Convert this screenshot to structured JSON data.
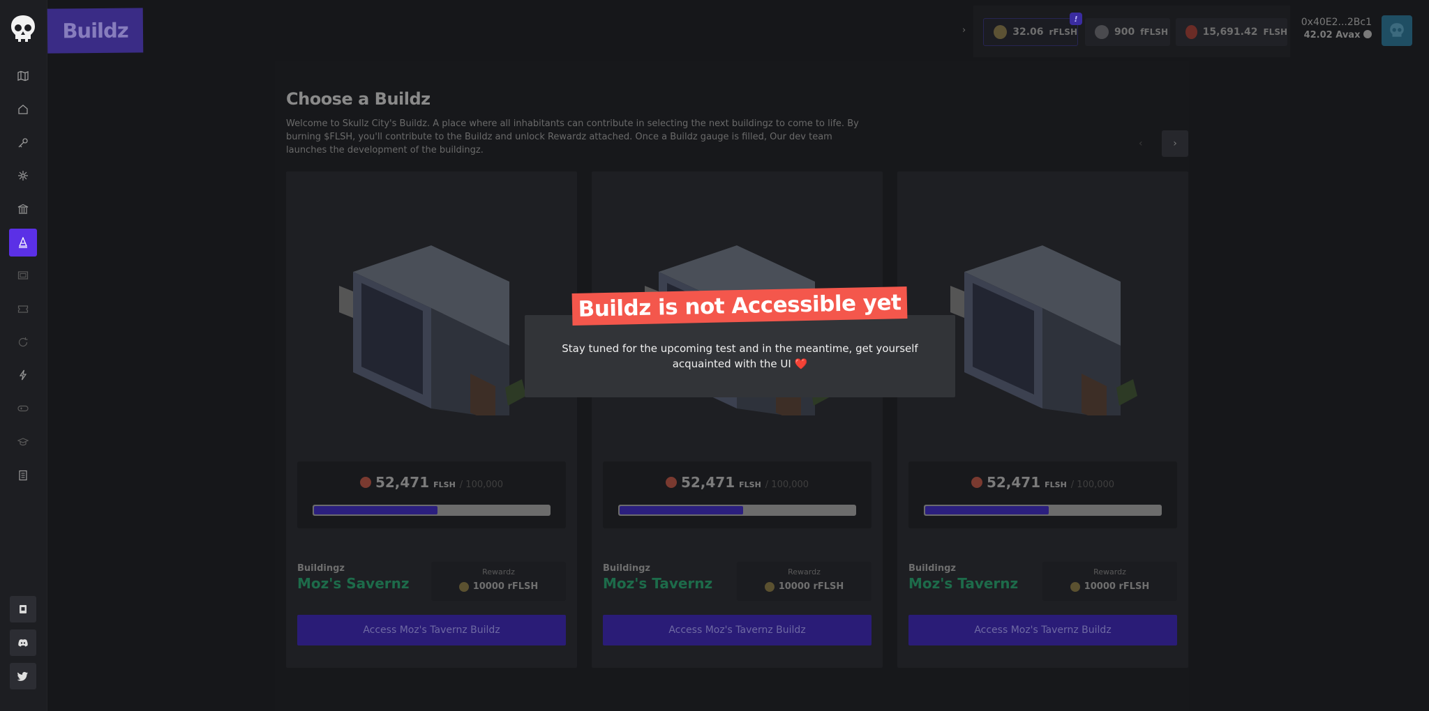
{
  "app": {
    "page_title": "Buildz"
  },
  "sidebar": {
    "items": [
      {
        "name": "map-icon",
        "active": false
      },
      {
        "name": "home-icon",
        "active": false
      },
      {
        "name": "key-icon",
        "active": false
      },
      {
        "name": "sparkle-icon",
        "active": false
      },
      {
        "name": "bank-icon",
        "active": false
      },
      {
        "name": "buildz-icon",
        "active": true
      },
      {
        "name": "frame-icon",
        "active": false
      },
      {
        "name": "ticket-icon",
        "active": false
      },
      {
        "name": "refresh-icon",
        "active": false
      },
      {
        "name": "flash-icon",
        "active": false
      },
      {
        "name": "gamepad-icon",
        "active": false
      },
      {
        "name": "hat-icon",
        "active": false
      },
      {
        "name": "document-icon",
        "active": false
      }
    ],
    "social": [
      "docs-icon",
      "discord-icon",
      "twitter-icon"
    ]
  },
  "topbar": {
    "balances": [
      {
        "value": "32.06",
        "unit": "rFLSH",
        "color": "#5c5234"
      },
      {
        "value": "900",
        "unit": "fFLSH",
        "color": "#4a4a4e"
      },
      {
        "value": "15,691.42",
        "unit": "FLSH",
        "color": "#6b2c26"
      }
    ],
    "notice": "!",
    "address": "0x40E2...2Bc1",
    "avax": "42.02 Avax",
    "chevron": "›"
  },
  "main": {
    "heading": "Choose a Buildz",
    "description": "Welcome to Skullz City's Buildz. A place where all inhabitants can contribute in selecting the next buildingz to come to life. By burning $FLSH, you'll contribute to the Buildz and unlock Rewardz attached. Once a Buildz gauge is filled, Our dev team launches the development of the buildingz.",
    "prev": "‹",
    "next": "›"
  },
  "cards": [
    {
      "amount": "52,471",
      "unit": "FLSH",
      "max": "/ 100,000",
      "progress": 0.5247,
      "label": "Buildingz",
      "name": "Moz's Savernz",
      "reward_label": "Rewardz",
      "reward": "10000 rFLSH",
      "button": "Access Moz's Tavernz Buildz"
    },
    {
      "amount": "52,471",
      "unit": "FLSH",
      "max": "/ 100,000",
      "progress": 0.5247,
      "label": "Buildingz",
      "name": "Moz's Tavernz",
      "reward_label": "Rewardz",
      "reward": "10000 rFLSH",
      "button": "Access Moz's Tavernz Buildz"
    },
    {
      "amount": "52,471",
      "unit": "FLSH",
      "max": "/ 100,000",
      "progress": 0.5247,
      "label": "Buildingz",
      "name": "Moz's Tavernz",
      "reward_label": "Rewardz",
      "reward": "10000 rFLSH",
      "button": "Access Moz's Tavernz Buildz"
    }
  ],
  "modal": {
    "banner": "Buildz is not Accessible yet",
    "message": "Stay tuned for the upcoming test and in the meantime, get yourself acquainted with the UI ❤️"
  }
}
